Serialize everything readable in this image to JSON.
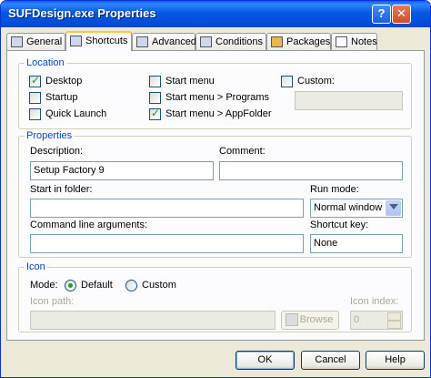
{
  "window": {
    "title": "SUFDesign.exe Properties"
  },
  "titlebar_buttons": {
    "help": "?",
    "close": "✕"
  },
  "tabs": [
    {
      "label": "General",
      "icon": "general-icon"
    },
    {
      "label": "Shortcuts",
      "icon": "shortcuts-icon",
      "active": true
    },
    {
      "label": "Advanced",
      "icon": "advanced-icon"
    },
    {
      "label": "Conditions",
      "icon": "conditions-icon"
    },
    {
      "label": "Packages",
      "icon": "packages-icon"
    },
    {
      "label": "Notes",
      "icon": "notes-icon"
    }
  ],
  "location": {
    "legend": "Location",
    "desktop": {
      "label": "Desktop",
      "checked": true
    },
    "startup": {
      "label": "Startup",
      "checked": false
    },
    "quick_launch": {
      "label": "Quick Launch",
      "checked": false
    },
    "start_menu": {
      "label": "Start menu",
      "checked": false
    },
    "start_menu_programs": {
      "label": "Start menu > Programs",
      "checked": false
    },
    "start_menu_appfolder": {
      "label": "Start menu > AppFolder",
      "checked": true
    },
    "custom": {
      "label": "Custom:",
      "checked": false,
      "value": ""
    }
  },
  "properties": {
    "legend": "Properties",
    "description_label": "Description:",
    "description_value": "Setup Factory 9",
    "comment_label": "Comment:",
    "comment_value": "",
    "start_in_label": "Start in folder:",
    "start_in_value": "",
    "run_mode_label": "Run mode:",
    "run_mode_value": "Normal window",
    "cmd_args_label": "Command line arguments:",
    "cmd_args_value": "",
    "shortcut_key_label": "Shortcut key:",
    "shortcut_key_value": "None"
  },
  "icon": {
    "legend": "Icon",
    "mode_label": "Mode:",
    "default_label": "Default",
    "custom_label": "Custom",
    "selected": "default",
    "icon_path_label": "Icon path:",
    "icon_path_value": "",
    "browse_label": "Browse",
    "icon_index_label": "Icon index:",
    "icon_index_value": "0"
  },
  "footer": {
    "ok": "OK",
    "cancel": "Cancel",
    "help": "Help"
  }
}
